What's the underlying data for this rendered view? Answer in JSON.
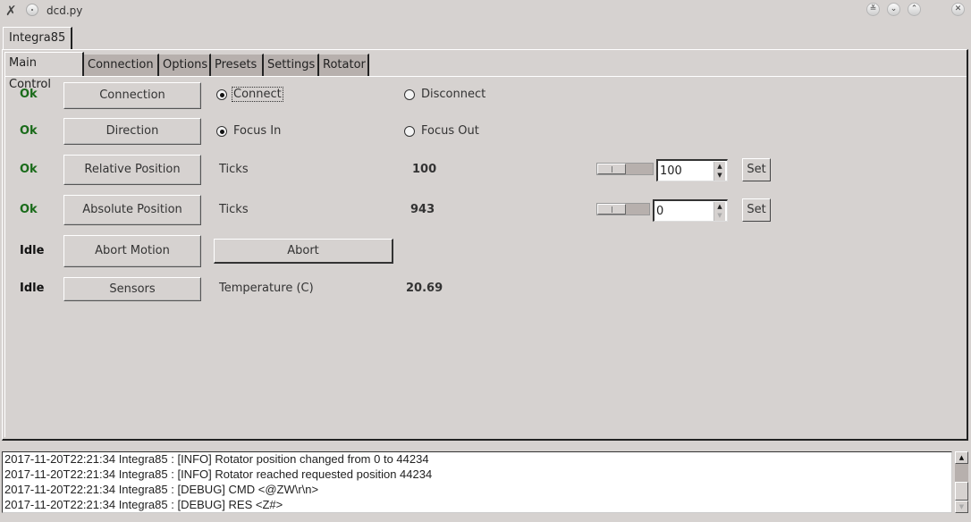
{
  "window": {
    "title": "dcd.py",
    "icons": {
      "app": "x-logo-icon",
      "menu": "window-menu-icon",
      "shade": "shade-icon",
      "minimize": "minimize-icon",
      "maximize": "maximize-icon",
      "close": "close-icon"
    },
    "glyphs": {
      "app": "✗",
      "shade": "≚",
      "minimize": "⌄",
      "maximize": "⌃",
      "close": "✕"
    }
  },
  "device_tab": {
    "label": "Integra85"
  },
  "tabs": [
    {
      "label": "Main Control",
      "active": true
    },
    {
      "label": "Connection",
      "active": false
    },
    {
      "label": "Options",
      "active": false
    },
    {
      "label": "Presets",
      "active": false
    },
    {
      "label": "Settings",
      "active": false
    },
    {
      "label": "Rotator",
      "active": false
    }
  ],
  "colors": {
    "ok": "#1a6b1a",
    "idle": "#111111",
    "background": "#d6d2d0",
    "tab_inactive": "#b7b0ad"
  },
  "rows": {
    "connection": {
      "status": "Ok",
      "label": "Connection",
      "options": [
        {
          "label": "Connect",
          "selected": true
        },
        {
          "label": "Disconnect",
          "selected": false
        }
      ]
    },
    "direction": {
      "status": "Ok",
      "label": "Direction",
      "options": [
        {
          "label": "Focus In",
          "selected": true
        },
        {
          "label": "Focus Out",
          "selected": false
        }
      ]
    },
    "relative_position": {
      "status": "Ok",
      "label": "Relative Position",
      "unit": "Ticks",
      "value": "100",
      "input_value": "100",
      "set_label": "Set"
    },
    "absolute_position": {
      "status": "Ok",
      "label": "Absolute Position",
      "unit": "Ticks",
      "value": "943",
      "input_value": "0",
      "set_label": "Set"
    },
    "abort_motion": {
      "status": "Idle",
      "label": "Abort Motion",
      "button_label": "Abort"
    },
    "sensors": {
      "status": "Idle",
      "label": "Sensors",
      "unit": "Temperature (C)",
      "value": "20.69"
    }
  },
  "log": {
    "lines": [
      "2017-11-20T22:21:34 Integra85 : [INFO] Rotator position changed from 0 to 44234",
      "2017-11-20T22:21:34 Integra85 : [INFO] Rotator reached requested position 44234",
      "2017-11-20T22:21:34 Integra85 : [DEBUG] CMD <@ZW\\r\\n>",
      "2017-11-20T22:21:34 Integra85 : [DEBUG] RES <Z#>"
    ]
  }
}
